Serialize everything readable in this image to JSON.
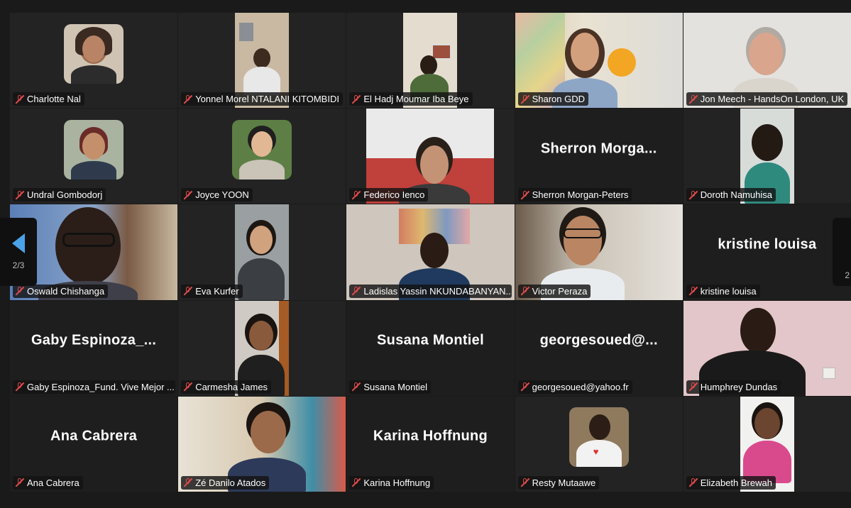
{
  "pagination": {
    "current_label": "2/3",
    "next_label": "2"
  },
  "participants": [
    {
      "name": "Charlotte Nal",
      "mic": "muted"
    },
    {
      "name": "Yonnel Morel NTALANI KITOMBIDI",
      "mic": "muted"
    },
    {
      "name": "El Hadj Moumar Iba Beye",
      "mic": "muted"
    },
    {
      "name": "Sharon GDD",
      "mic": "muted"
    },
    {
      "name": "Jon Meech - HandsOn London, UK",
      "mic": "muted"
    },
    {
      "name": "Undral Gombodorj",
      "mic": "muted"
    },
    {
      "name": "Joyce YOON",
      "mic": "muted"
    },
    {
      "name": "Federico Ienco",
      "mic": "muted"
    },
    {
      "name": "Sherron Morgan-Peters",
      "display": "Sherron  Morga...",
      "mic": "muted"
    },
    {
      "name": "Doroth Namuhisa",
      "mic": "muted"
    },
    {
      "name": "Oswald Chishanga",
      "mic": "muted"
    },
    {
      "name": "Eva Kurfer",
      "mic": "muted"
    },
    {
      "name": "Ladislas Yassin NKUNDABANYAN...",
      "mic": "muted"
    },
    {
      "name": "Victor Peraza",
      "mic": "muted"
    },
    {
      "name": "kristine louisa",
      "display": "kristine louisa",
      "mic": "muted"
    },
    {
      "name": "Gaby Espinoza_Fund. Vive Mejor ...",
      "display": "Gaby  Espinoza_...",
      "mic": "muted"
    },
    {
      "name": "Carmesha James",
      "mic": "muted"
    },
    {
      "name": "Susana Montiel",
      "display": "Susana Montiel",
      "mic": "muted"
    },
    {
      "name": "georgesoued@yahoo.fr",
      "display": "georgesoued@...",
      "mic": "muted"
    },
    {
      "name": "Humphrey Dundas",
      "mic": "muted"
    },
    {
      "name": "Ana Cabrera",
      "display": "Ana Cabrera",
      "mic": "muted"
    },
    {
      "name": "Zé Danilo Atados",
      "mic": "muted"
    },
    {
      "name": "Karina Hoffnung",
      "display": "Karina Hoffnung",
      "mic": "muted"
    },
    {
      "name": "Resty Mutaawe",
      "mic": "muted"
    },
    {
      "name": "Elizabeth Brewah",
      "mic": "muted"
    }
  ],
  "colors": {
    "background": "#1a1a1a",
    "muted_icon": "#e24a4a",
    "nav_arrow": "#4aa3e8"
  }
}
